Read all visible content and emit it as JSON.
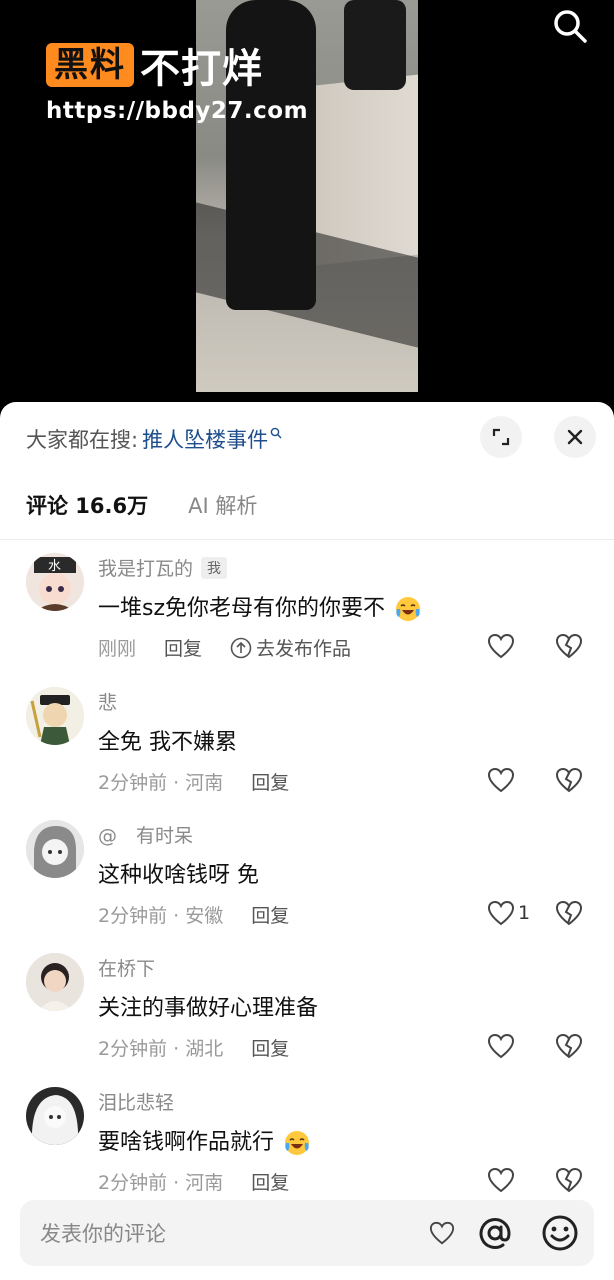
{
  "watermark": {
    "badge": "黑料",
    "title": "不打烊",
    "url": "https://bbdy27.com"
  },
  "search": {
    "label": "大家都在搜:",
    "query": "推人坠楼事件"
  },
  "tabs": {
    "comments": "评论 16.6万",
    "ai": "AI 解析"
  },
  "comments": [
    {
      "author": "我是打瓦的",
      "me_tag": "我",
      "text": "一堆sz免你老母有你的你要不",
      "time": "刚刚",
      "reply": "回复",
      "publish": "去发布作品",
      "likes": "",
      "emoji": "crying-laughing"
    },
    {
      "author": "悲",
      "text": "全免 我不嫌累",
      "time": "2分钟前 · 河南",
      "reply": "回复",
      "likes": ""
    },
    {
      "author": "@　有时呆",
      "text": "这种收啥钱呀 免",
      "time": "2分钟前 · 安徽",
      "reply": "回复",
      "likes": "1"
    },
    {
      "author": "在桥下",
      "text": "关注的事做好心理准备",
      "time": "2分钟前 · 湖北",
      "reply": "回复",
      "likes": ""
    },
    {
      "author": "泪比悲轻",
      "text": "要啥钱啊作品就行",
      "time": "2分钟前 · 河南",
      "reply": "回复",
      "likes": "",
      "emoji": "crying-laughing"
    }
  ],
  "input": {
    "placeholder": "发表你的评论"
  },
  "icons": {
    "search_top": "search-icon",
    "expand": "expand-icon",
    "close": "close-icon",
    "like": "heart-icon",
    "dislike": "broken-heart-icon",
    "at": "at-icon",
    "emoji": "smiley-icon"
  },
  "colors": {
    "link": "#1f4e8c",
    "watermark_badge": "#ff8a1e"
  }
}
